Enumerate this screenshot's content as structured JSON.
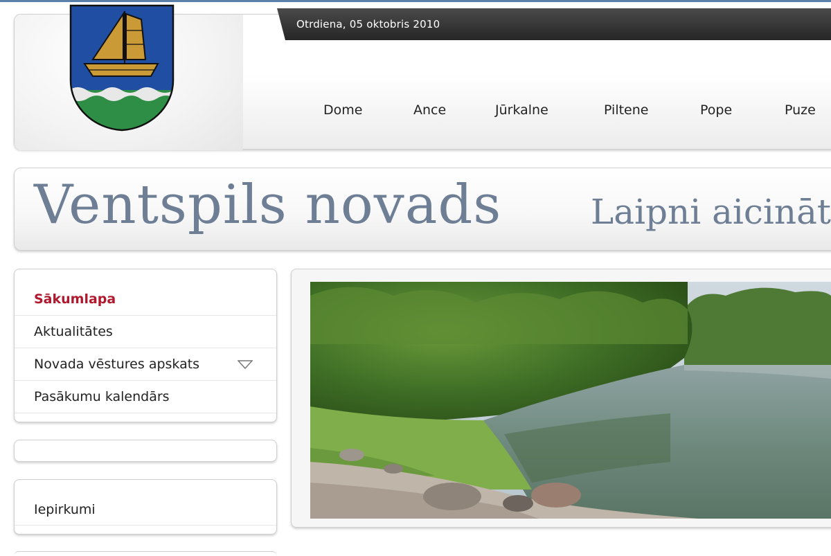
{
  "header": {
    "date": "Otrdiena, 05 oktobris 2010",
    "nav": [
      "Dome",
      "Ance",
      "Jūrkalne",
      "Piltene",
      "Pope",
      "Puze"
    ]
  },
  "banner": {
    "site_title": "Ventspils novads",
    "welcome": "Laipni aicināti"
  },
  "sidebar": {
    "menu": [
      "Sākumlapa",
      "Aktualitātes",
      "Novada vēstures apskats",
      "Pasākumu kalendārs"
    ],
    "active_index": 0,
    "second_box": [
      "Iepirkumi"
    ]
  },
  "icons": {
    "logo": "coat-of-arms-boat",
    "submenu": "chevron-down-icon"
  },
  "colors": {
    "accent": "#b0182e",
    "title": "#6e7f95",
    "topline": "#5a7fa8",
    "datebar": "#2f2f2f"
  }
}
